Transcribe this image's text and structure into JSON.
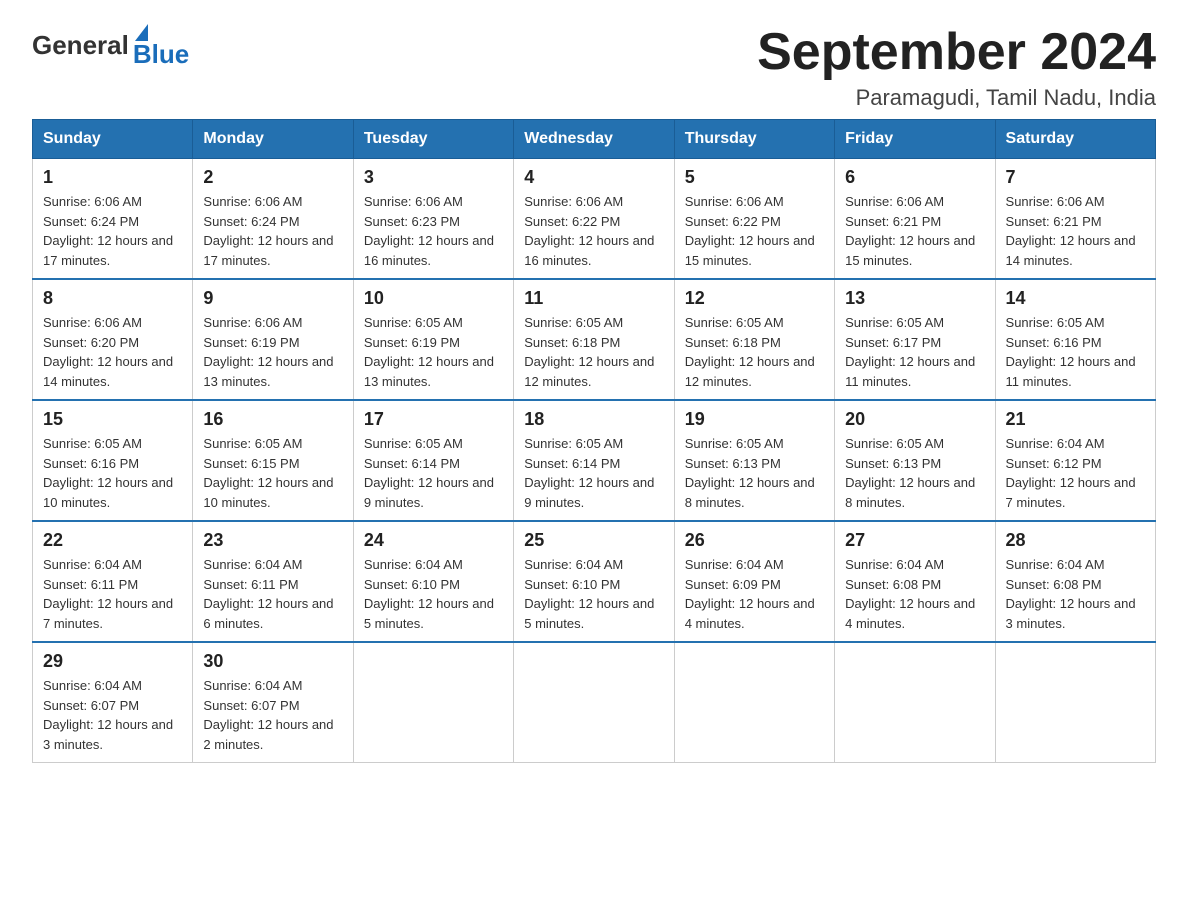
{
  "logo": {
    "general": "General",
    "blue": "Blue"
  },
  "title": "September 2024",
  "location": "Paramagudi, Tamil Nadu, India",
  "days_of_week": [
    "Sunday",
    "Monday",
    "Tuesday",
    "Wednesday",
    "Thursday",
    "Friday",
    "Saturday"
  ],
  "weeks": [
    [
      {
        "day": "1",
        "sunrise": "6:06 AM",
        "sunset": "6:24 PM",
        "daylight": "12 hours and 17 minutes."
      },
      {
        "day": "2",
        "sunrise": "6:06 AM",
        "sunset": "6:24 PM",
        "daylight": "12 hours and 17 minutes."
      },
      {
        "day": "3",
        "sunrise": "6:06 AM",
        "sunset": "6:23 PM",
        "daylight": "12 hours and 16 minutes."
      },
      {
        "day": "4",
        "sunrise": "6:06 AM",
        "sunset": "6:22 PM",
        "daylight": "12 hours and 16 minutes."
      },
      {
        "day": "5",
        "sunrise": "6:06 AM",
        "sunset": "6:22 PM",
        "daylight": "12 hours and 15 minutes."
      },
      {
        "day": "6",
        "sunrise": "6:06 AM",
        "sunset": "6:21 PM",
        "daylight": "12 hours and 15 minutes."
      },
      {
        "day": "7",
        "sunrise": "6:06 AM",
        "sunset": "6:21 PM",
        "daylight": "12 hours and 14 minutes."
      }
    ],
    [
      {
        "day": "8",
        "sunrise": "6:06 AM",
        "sunset": "6:20 PM",
        "daylight": "12 hours and 14 minutes."
      },
      {
        "day": "9",
        "sunrise": "6:06 AM",
        "sunset": "6:19 PM",
        "daylight": "12 hours and 13 minutes."
      },
      {
        "day": "10",
        "sunrise": "6:05 AM",
        "sunset": "6:19 PM",
        "daylight": "12 hours and 13 minutes."
      },
      {
        "day": "11",
        "sunrise": "6:05 AM",
        "sunset": "6:18 PM",
        "daylight": "12 hours and 12 minutes."
      },
      {
        "day": "12",
        "sunrise": "6:05 AM",
        "sunset": "6:18 PM",
        "daylight": "12 hours and 12 minutes."
      },
      {
        "day": "13",
        "sunrise": "6:05 AM",
        "sunset": "6:17 PM",
        "daylight": "12 hours and 11 minutes."
      },
      {
        "day": "14",
        "sunrise": "6:05 AM",
        "sunset": "6:16 PM",
        "daylight": "12 hours and 11 minutes."
      }
    ],
    [
      {
        "day": "15",
        "sunrise": "6:05 AM",
        "sunset": "6:16 PM",
        "daylight": "12 hours and 10 minutes."
      },
      {
        "day": "16",
        "sunrise": "6:05 AM",
        "sunset": "6:15 PM",
        "daylight": "12 hours and 10 minutes."
      },
      {
        "day": "17",
        "sunrise": "6:05 AM",
        "sunset": "6:14 PM",
        "daylight": "12 hours and 9 minutes."
      },
      {
        "day": "18",
        "sunrise": "6:05 AM",
        "sunset": "6:14 PM",
        "daylight": "12 hours and 9 minutes."
      },
      {
        "day": "19",
        "sunrise": "6:05 AM",
        "sunset": "6:13 PM",
        "daylight": "12 hours and 8 minutes."
      },
      {
        "day": "20",
        "sunrise": "6:05 AM",
        "sunset": "6:13 PM",
        "daylight": "12 hours and 8 minutes."
      },
      {
        "day": "21",
        "sunrise": "6:04 AM",
        "sunset": "6:12 PM",
        "daylight": "12 hours and 7 minutes."
      }
    ],
    [
      {
        "day": "22",
        "sunrise": "6:04 AM",
        "sunset": "6:11 PM",
        "daylight": "12 hours and 7 minutes."
      },
      {
        "day": "23",
        "sunrise": "6:04 AM",
        "sunset": "6:11 PM",
        "daylight": "12 hours and 6 minutes."
      },
      {
        "day": "24",
        "sunrise": "6:04 AM",
        "sunset": "6:10 PM",
        "daylight": "12 hours and 5 minutes."
      },
      {
        "day": "25",
        "sunrise": "6:04 AM",
        "sunset": "6:10 PM",
        "daylight": "12 hours and 5 minutes."
      },
      {
        "day": "26",
        "sunrise": "6:04 AM",
        "sunset": "6:09 PM",
        "daylight": "12 hours and 4 minutes."
      },
      {
        "day": "27",
        "sunrise": "6:04 AM",
        "sunset": "6:08 PM",
        "daylight": "12 hours and 4 minutes."
      },
      {
        "day": "28",
        "sunrise": "6:04 AM",
        "sunset": "6:08 PM",
        "daylight": "12 hours and 3 minutes."
      }
    ],
    [
      {
        "day": "29",
        "sunrise": "6:04 AM",
        "sunset": "6:07 PM",
        "daylight": "12 hours and 3 minutes."
      },
      {
        "day": "30",
        "sunrise": "6:04 AM",
        "sunset": "6:07 PM",
        "daylight": "12 hours and 2 minutes."
      },
      null,
      null,
      null,
      null,
      null
    ]
  ]
}
